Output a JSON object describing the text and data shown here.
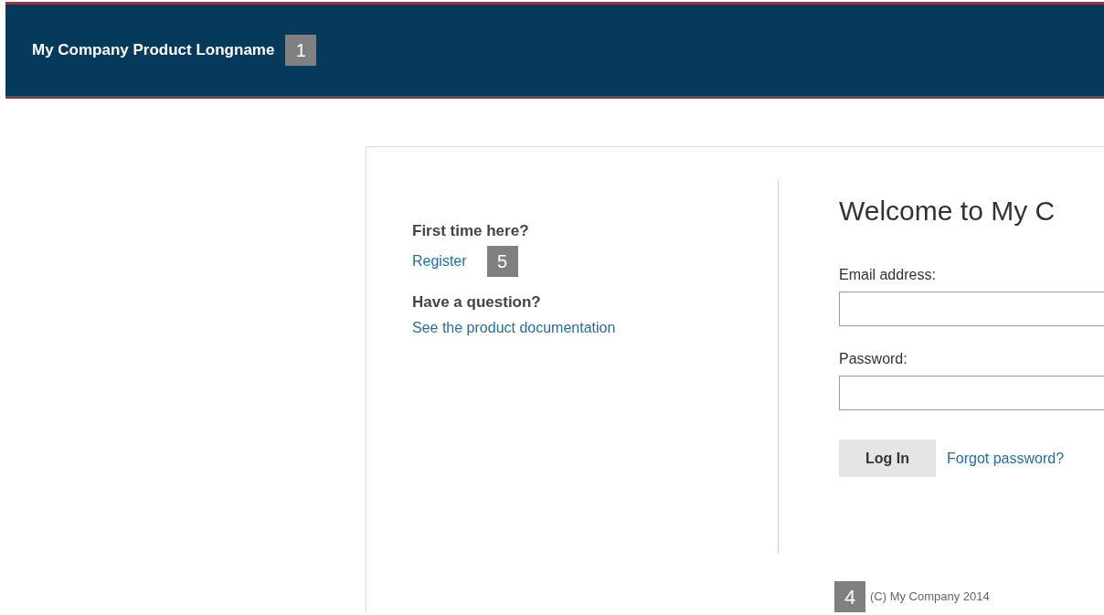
{
  "header": {
    "title": "My Company Product Longname",
    "marker": "1"
  },
  "left": {
    "sections": [
      {
        "heading": "First time here?",
        "link": "Register",
        "marker": "5"
      },
      {
        "heading": "Have a question?",
        "link": "See the product documentation"
      }
    ]
  },
  "login": {
    "title": "Welcome to My C",
    "fields": [
      {
        "label": "Email address:"
      },
      {
        "label": "Password:"
      }
    ],
    "button": "Log In",
    "link": "Forgot password?"
  },
  "footer": {
    "marker": "4",
    "text": "(C) My Company 2014"
  }
}
